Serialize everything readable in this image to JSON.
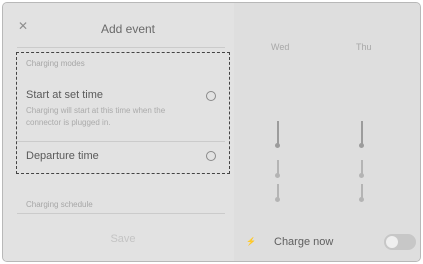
{
  "panel": {
    "title": "Add event",
    "close_icon": "close-icon",
    "modes_label": "Charging modes",
    "options": [
      {
        "label": "Start at set time",
        "description": "Charging will start at this time when the connector is plugged in.",
        "selected": false
      },
      {
        "label": "Departure time",
        "description": "",
        "selected": false
      }
    ],
    "schedule_label": "Charging schedule",
    "save_label": "Save"
  },
  "calendar": {
    "days": [
      "Wed",
      "Thu"
    ]
  },
  "bottom": {
    "plug_icon": "plug-icon",
    "charge_now_label": "Charge now",
    "charge_now_on": false
  },
  "colors": {
    "panel_bg": "#e2e2e2",
    "calendar_bg": "#dedede",
    "highlight_border": "#444444"
  }
}
